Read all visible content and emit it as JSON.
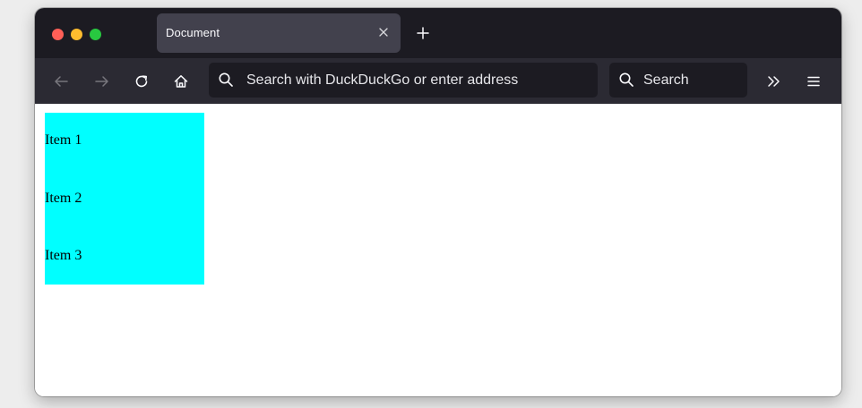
{
  "browser": {
    "tab": {
      "title": "Document"
    },
    "address_bar": {
      "placeholder": "Search with DuckDuckGo or enter address"
    },
    "search_bar": {
      "placeholder": "Search"
    }
  },
  "page": {
    "items": [
      "Item 1",
      "Item 2",
      "Item 3"
    ],
    "list_background": "#00ffff"
  },
  "icons": {
    "back": "back-arrow-icon",
    "forward": "forward-arrow-icon",
    "reload": "reload-icon",
    "home": "home-icon",
    "url_search": "search-icon",
    "search": "search-icon",
    "overflow": "chevron-double-right-icon",
    "menu": "hamburger-menu-icon",
    "tab_close": "close-icon",
    "new_tab": "plus-icon"
  },
  "colors": {
    "traffic_close": "#ff5f57",
    "traffic_minimize": "#febc2e",
    "traffic_maximize": "#28c840",
    "tabbar_bg": "#1c1b22",
    "toolbar_bg": "#2b2a33"
  }
}
